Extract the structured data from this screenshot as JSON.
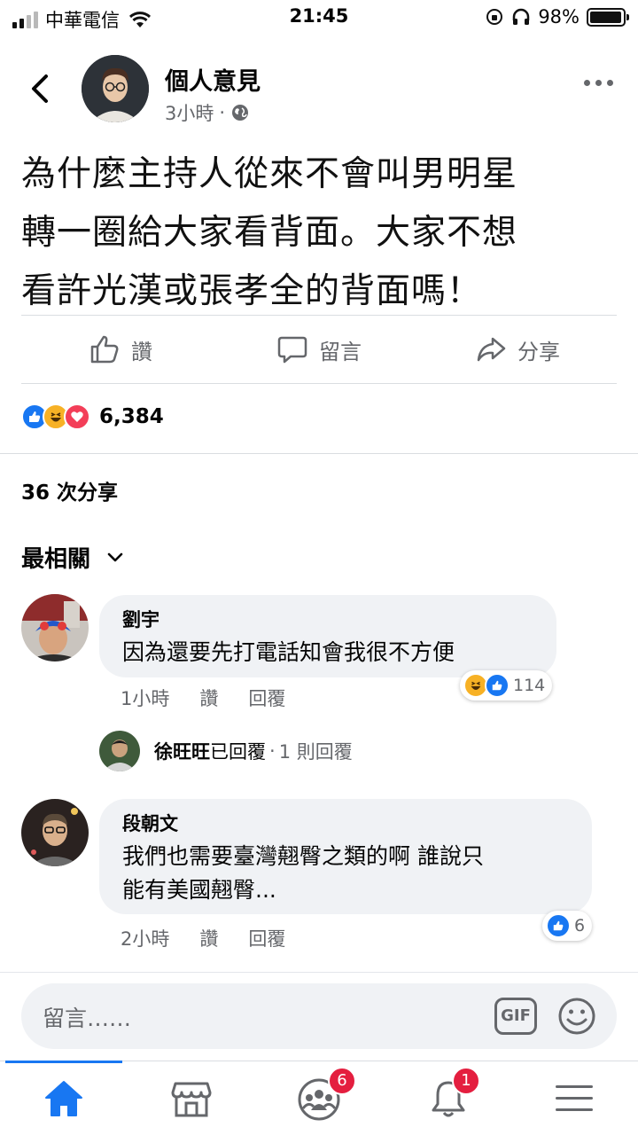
{
  "status_bar": {
    "carrier": "中華電信",
    "time": "21:45",
    "battery": "98%",
    "battery_level": 0.98
  },
  "post": {
    "author": "個人意見",
    "time_ago": "3小時",
    "separator": "·",
    "text_lines": [
      "為什麼主持人從來不會叫男明星",
      "轉一圈給大家看背面。大家不想",
      "看許光漢或張孝全的背面嗎！"
    ],
    "actions": {
      "like": "讚",
      "comment": "留言",
      "share": "分享"
    },
    "reaction_count": "6,384",
    "shares": "36 次分享"
  },
  "comments_filter": "最相關",
  "comments": [
    {
      "name": "劉宇",
      "text_lines": [
        "因為還要先打電話知會我很不方便"
      ],
      "time": "1小時",
      "like": "讚",
      "reply": "回覆",
      "reactions": "114",
      "reply_summary": {
        "name": "徐旺旺",
        "action": "已回覆",
        "dot": "·",
        "count": "1 則回覆"
      }
    },
    {
      "name": "段朝文",
      "text_lines": [
        "我們也需要臺灣翹臀之類的啊 誰說只",
        "能有美國翹臀..."
      ],
      "time": "2小時",
      "like": "讚",
      "reply": "回覆",
      "reactions": "6"
    }
  ],
  "composer": {
    "placeholder": "留言……",
    "gif": "GIF"
  },
  "tabbar": {
    "groups_badge": "6",
    "notifications_badge": "1"
  },
  "colors": {
    "accent": "#1877f2",
    "like": "#1877f2",
    "love": "#f33e58",
    "haha": "#f7b125",
    "badge": "#e41e3f"
  }
}
